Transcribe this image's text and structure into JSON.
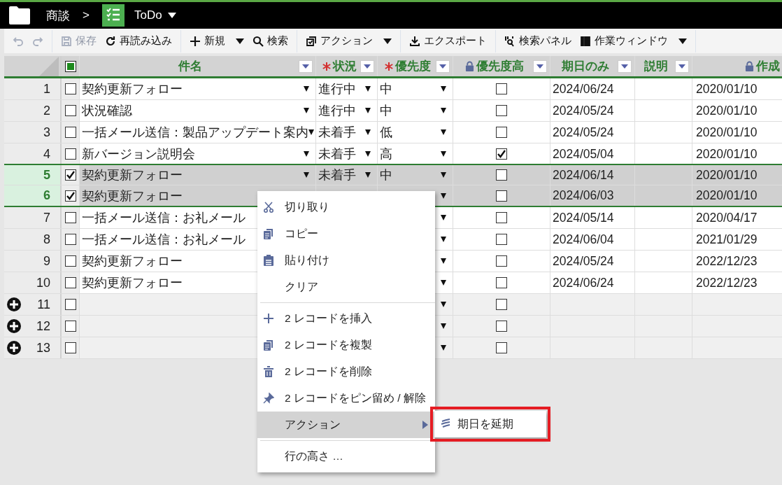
{
  "breadcrumb": {
    "parent": "商談",
    "separator": ">",
    "current": "ToDo"
  },
  "toolbar": [
    {
      "kind": "undo",
      "disabled": true
    },
    {
      "kind": "redo",
      "disabled": true
    },
    {
      "kind": "separator"
    },
    {
      "kind": "save",
      "label": "保存",
      "disabled": true
    },
    {
      "kind": "reload",
      "label": "再読み込み",
      "disabled": false
    },
    {
      "kind": "separator"
    },
    {
      "kind": "new",
      "label": "新規",
      "disabled": false,
      "dropdown": true
    },
    {
      "kind": "search",
      "label": "検索",
      "disabled": false
    },
    {
      "kind": "separator"
    },
    {
      "kind": "action",
      "label": "アクション",
      "disabled": false,
      "dropdown": true
    },
    {
      "kind": "separator"
    },
    {
      "kind": "export",
      "label": "エクスポート",
      "disabled": false
    },
    {
      "kind": "separator"
    },
    {
      "kind": "panel",
      "label": "検索パネル",
      "disabled": false
    },
    {
      "kind": "window",
      "label": "作業ウィンドウ",
      "disabled": false,
      "dropdown": true
    },
    {
      "kind": "separator"
    }
  ],
  "columns": [
    {
      "label": "件名",
      "required": false,
      "locked": false,
      "filter": true
    },
    {
      "label": "状況",
      "required": true,
      "locked": false,
      "filter": true
    },
    {
      "label": "優先度",
      "required": true,
      "locked": false,
      "filter": true
    },
    {
      "label": "優先度高",
      "required": false,
      "locked": true,
      "filter": true
    },
    {
      "label": "期日のみ",
      "required": false,
      "locked": false,
      "filter": true
    },
    {
      "label": "説明",
      "required": false,
      "locked": false,
      "filter": true
    },
    {
      "label": "作成",
      "required": false,
      "locked": true,
      "filter": false
    }
  ],
  "header_checkbox": {
    "checked": true
  },
  "rows": [
    {
      "kind": "record",
      "number": "1",
      "selected": false,
      "title": "契約更新フォロー",
      "status": "進行中",
      "priority": "中",
      "high": false,
      "due": "2024/06/24",
      "created": "2020/01/10"
    },
    {
      "kind": "record",
      "number": "2",
      "selected": false,
      "title": "状況確認",
      "status": "進行中",
      "priority": "中",
      "high": false,
      "due": "2024/05/24",
      "created": "2020/01/10"
    },
    {
      "kind": "record",
      "number": "3",
      "selected": false,
      "title": "一括メール送信：製品アップデート案内",
      "status": "未着手",
      "priority": "低",
      "high": false,
      "due": "2024/05/24",
      "created": "2020/01/10"
    },
    {
      "kind": "record",
      "number": "4",
      "selected": false,
      "title": "新バージョン説明会",
      "status": "未着手",
      "priority": "高",
      "high": true,
      "due": "2024/05/04",
      "created": "2020/01/10"
    },
    {
      "kind": "record",
      "number": "5",
      "selected": true,
      "title": "契約更新フォロー",
      "status": "未着手",
      "priority": "中",
      "high": false,
      "due": "2024/06/14",
      "created": "2020/01/10"
    },
    {
      "kind": "record",
      "number": "6",
      "selected": true,
      "title": "契約更新フォロー",
      "high": false,
      "due": "2024/06/03",
      "created": "2020/01/10"
    },
    {
      "kind": "record",
      "number": "7",
      "selected": false,
      "title": "一括メール送信：お礼メール",
      "high": false,
      "due": "2024/05/14",
      "created": "2020/04/17"
    },
    {
      "kind": "record",
      "number": "8",
      "selected": false,
      "title": "一括メール送信：お礼メール",
      "high": false,
      "due": "2024/06/04",
      "created": "2021/01/29"
    },
    {
      "kind": "record",
      "number": "9",
      "selected": false,
      "title": "契約更新フォロー",
      "high": false,
      "due": "2024/05/24",
      "created": "2022/12/23"
    },
    {
      "kind": "record",
      "number": "10",
      "selected": false,
      "title": "契約更新フォロー",
      "high": false,
      "due": "2024/06/24",
      "created": "2022/12/23"
    },
    {
      "kind": "new",
      "number": "11",
      "selected": false,
      "high": false
    },
    {
      "kind": "new",
      "number": "12",
      "selected": false,
      "high": false
    },
    {
      "kind": "new",
      "number": "13",
      "selected": false,
      "high": false
    }
  ],
  "context_menu": [
    {
      "kind": "cut",
      "label": "切り取り",
      "selected": false
    },
    {
      "kind": "copy",
      "label": "コピー",
      "selected": false
    },
    {
      "kind": "paste",
      "label": "貼り付け",
      "selected": false
    },
    {
      "kind": "plain",
      "label": "クリア",
      "selected": false
    },
    {
      "kind": "separator"
    },
    {
      "kind": "insert",
      "label": "2 レコードを挿入",
      "selected": false
    },
    {
      "kind": "duplicate",
      "label": "2 レコードを複製",
      "selected": false
    },
    {
      "kind": "delete",
      "label": "2 レコードを削除",
      "selected": false
    },
    {
      "kind": "pin",
      "label": "2 レコードをピン留め / 解除",
      "selected": false
    },
    {
      "kind": "submenu",
      "label": "アクション",
      "selected": true
    },
    {
      "kind": "separator"
    },
    {
      "kind": "plain",
      "label": "行の高さ …",
      "selected": false
    }
  ],
  "submenu": [
    {
      "label": "期日を延期",
      "highlighted": true
    }
  ]
}
